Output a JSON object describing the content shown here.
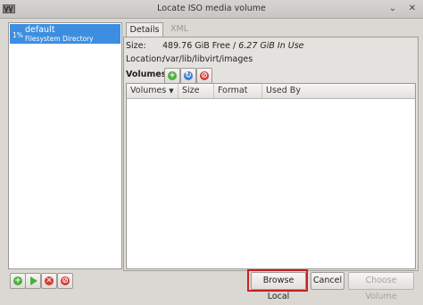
{
  "window": {
    "title": "Locate ISO media volume",
    "minimize_glyph": "⌄",
    "close_glyph": "✕"
  },
  "pools": [
    {
      "percent": "1%",
      "name": "default",
      "type": "Filesystem Directory",
      "selected": true
    }
  ],
  "tabs": [
    {
      "label": "Details",
      "active": true
    },
    {
      "label": "XML",
      "active": false
    }
  ],
  "details": {
    "size_label": "Size:",
    "size_free": "489.76 GiB Free /",
    "size_used": "6.27 GiB In Use",
    "location_label": "Location:",
    "location_value": "/var/lib/libvirt/images",
    "volumes_label": "Volumes"
  },
  "volume_buttons": {
    "add_icon": "add-icon",
    "refresh_icon": "refresh-icon",
    "delete_icon": "delete-icon",
    "add_glyph": "+",
    "refresh_glyph": "↻",
    "delete_glyph": "⊘"
  },
  "volume_table": {
    "columns": [
      "Volumes",
      "Size",
      "Format",
      "Used By"
    ],
    "sort_glyph": "▼",
    "rows": []
  },
  "pool_buttons": {
    "add_glyph": "+",
    "stop_glyph": "✕",
    "delete_glyph": "⊘"
  },
  "buttons": {
    "browse_local": "Browse Local",
    "cancel": "Cancel",
    "choose_volume": "Choose Volume"
  },
  "colors": {
    "selection": "#3d8ee0",
    "highlight_box": "#c82020"
  }
}
